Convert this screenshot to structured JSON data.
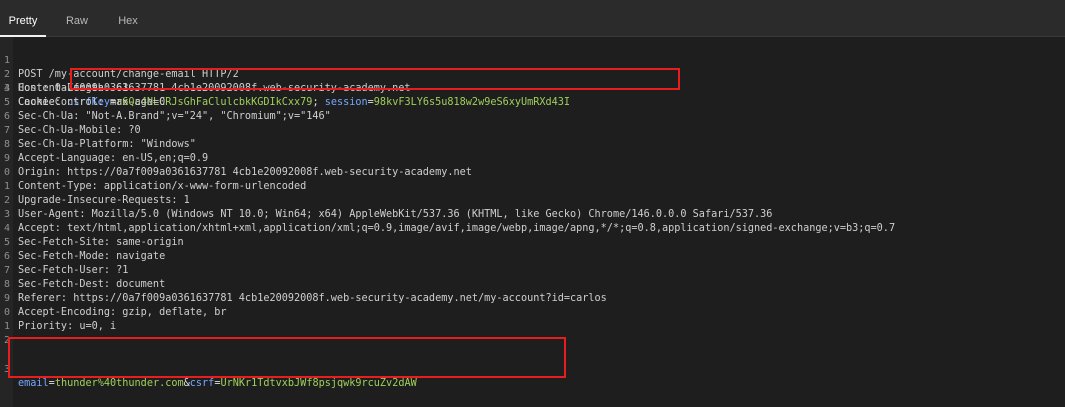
{
  "tabs": {
    "pretty": "Pretty",
    "raw": "Raw",
    "hex": "Hex"
  },
  "request": {
    "lines": [
      {
        "num": "1",
        "text": "POST /my-account/change-email HTTP/2"
      },
      {
        "num": "2",
        "text": "Host: 0a7f009a0361637781 4cb1e20092008f.web-security-academy.net"
      },
      {
        "num": "3",
        "text": ""
      },
      {
        "num": "4",
        "text": "Content-Length: 63"
      },
      {
        "num": "5",
        "text": "Cache-Control: max-age=0"
      },
      {
        "num": "6",
        "text": "Sec-Ch-Ua: \"Not-A.Brand\";v=\"24\", \"Chromium\";v=\"146\""
      },
      {
        "num": "7",
        "text": "Sec-Ch-Ua-Mobile: ?0"
      },
      {
        "num": "8",
        "text": "Sec-Ch-Ua-Platform: \"Windows\""
      },
      {
        "num": "9",
        "text": "Accept-Language: en-US,en;q=0.9"
      },
      {
        "num": "0",
        "text": "Origin: https://0a7f009a0361637781 4cb1e20092008f.web-security-academy.net"
      },
      {
        "num": "1",
        "text": "Content-Type: application/x-www-form-urlencoded"
      },
      {
        "num": "2",
        "text": "Upgrade-Insecure-Requests: 1"
      },
      {
        "num": "3",
        "text": "User-Agent: Mozilla/5.0 (Windows NT 10.0; Win64; x64) AppleWebKit/537.36 (KHTML, like Gecko) Chrome/146.0.0.0 Safari/537.36"
      },
      {
        "num": "4",
        "text": "Accept: text/html,application/xhtml+xml,application/xml;q=0.9,image/avif,image/webp,image/apng,*/*;q=0.8,application/signed-exchange;v=b3;q=0.7"
      },
      {
        "num": "5",
        "text": "Sec-Fetch-Site: same-origin"
      },
      {
        "num": "6",
        "text": "Sec-Fetch-Mode: navigate"
      },
      {
        "num": "7",
        "text": "Sec-Fetch-User: ?1"
      },
      {
        "num": "8",
        "text": "Sec-Fetch-Dest: document"
      },
      {
        "num": "9",
        "text": "Referer: https://0a7f009a0361637781 4cb1e20092008f.web-security-academy.net/my-account?id=carlos"
      },
      {
        "num": "0",
        "text": "Accept-Encoding: gzip, deflate, br"
      },
      {
        "num": "1",
        "text": "Priority: u=0, i"
      },
      {
        "num": "2",
        "text": ""
      },
      {
        "num": "3",
        "text": ""
      }
    ],
    "cookie": {
      "label": "Cookie: ",
      "csrf_key_name": "csrfKey",
      "csrf_key_value": "r6Qc4NLCRJsGhFaClulcbkKGDIkCxx79",
      "separator": "; ",
      "session_name": "session",
      "session_value": "98kvF3LY6s5u818w2w9eS6xyUmRXd43I"
    },
    "body": {
      "email_name": "email",
      "email_value": "thunder%40thunder.com",
      "amp": "&",
      "csrf_name": "csrf",
      "csrf_value": "UrNKr1TdtvxbJWf8psjqwk9rcuZv2dAW"
    }
  },
  "colors": {
    "highlight_box": "#e81e1e",
    "param_name": "#74a7ff",
    "param_value": "#9fd05a"
  }
}
